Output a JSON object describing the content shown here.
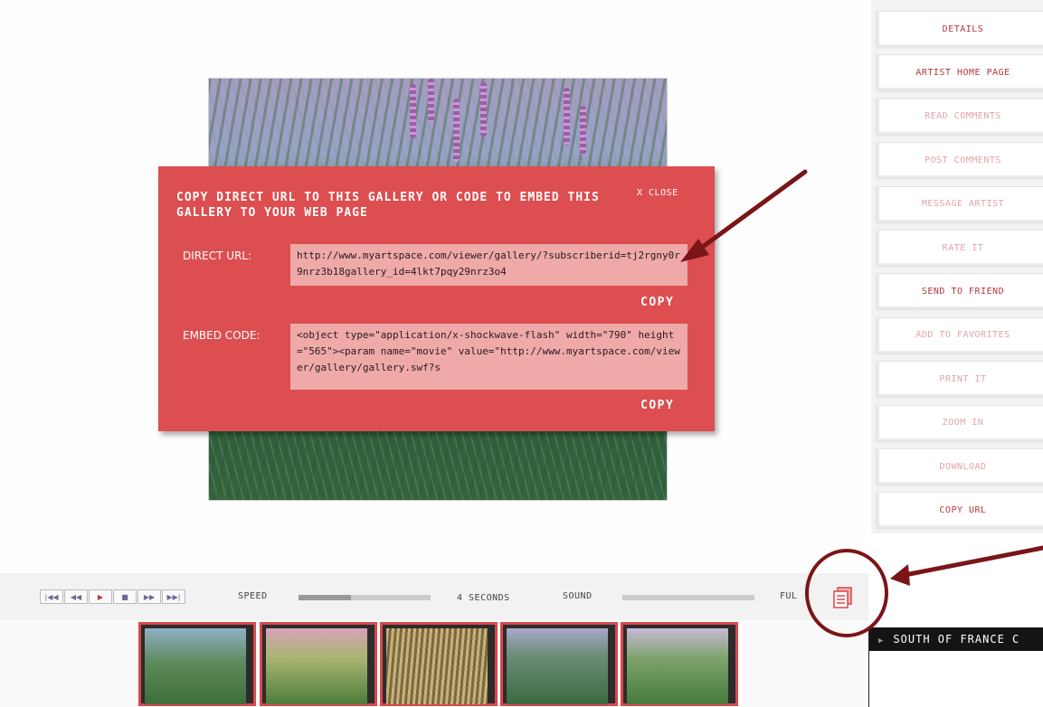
{
  "modal": {
    "title": "COPY DIRECT URL TO THIS GALLERY OR CODE TO EMBED THIS GALLERY TO YOUR WEB PAGE",
    "close_label": "X CLOSE",
    "direct_url_label": "DIRECT URL:",
    "direct_url_value": "http://www.myartspace.com/viewer/gallery/?subscriberid=tj2rgny0r9nrz3b18gallery_id=4lkt7pqy29nrz3o4",
    "embed_code_label": "EMBED CODE:",
    "embed_code_value": "<object type=\"application/x-shockwave-flash\" width=\"790\" height=\"565\"><param name=\"movie\" value=\"http://www.myartspace.com/viewer/gallery/gallery.swf?s",
    "copy_label_1": "COPY",
    "copy_label_2": "COPY"
  },
  "sidebar": {
    "items": [
      {
        "label": "DETAILS",
        "state": "active"
      },
      {
        "label": "ARTIST HOME PAGE",
        "state": "active"
      },
      {
        "label": "READ COMMENTS",
        "state": "dim"
      },
      {
        "label": "POST COMMENTS",
        "state": "dim"
      },
      {
        "label": "MESSAGE ARTIST",
        "state": "dim"
      },
      {
        "label": "RATE IT",
        "state": "dim"
      },
      {
        "label": "SEND TO FRIEND",
        "state": "active"
      },
      {
        "label": "ADD TO FAVORITES",
        "state": "dim"
      },
      {
        "label": "PRINT IT",
        "state": "dim"
      },
      {
        "label": "ZOOM IN",
        "state": "dim"
      },
      {
        "label": "DOWNLOAD",
        "state": "dim"
      },
      {
        "label": "COPY URL",
        "state": "active"
      }
    ]
  },
  "controls": {
    "buttons": [
      "first-icon",
      "rewind-icon",
      "play-icon",
      "stop-icon",
      "forward-icon",
      "last-icon"
    ],
    "speed_label": "SPEED",
    "speed_value": "4 SECONDS",
    "speed_level": 0.4,
    "sound_label": "SOUND",
    "sound_level": 0.0,
    "full_label": "FUL"
  },
  "gallery": {
    "title": "SOUTH OF FRANCE C"
  },
  "colors": {
    "accent": "#dc4e4f",
    "accent_light": "#efa9a9",
    "annotation": "#7a1518"
  }
}
